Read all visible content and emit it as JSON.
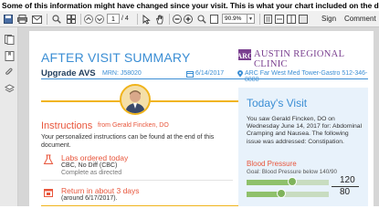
{
  "banner": "Some of this information might have changed since your visit. This is what your chart included on the day of your visit.",
  "toolbar": {
    "page_current": "1",
    "page_total": "/ 4",
    "zoom": "90.9%",
    "sign_label": "Sign",
    "comment_label": "Comment"
  },
  "document": {
    "title": "AFTER VISIT SUMMARY",
    "clinic_name": "AUSTIN REGIONAL CLINIC",
    "patient_name": "Upgrade AVS",
    "mrn": "MRN: J58020",
    "visit_date": "6/14/2017",
    "location": "ARC Far West Med Tower-Gastro 512-346-8888",
    "instructions": {
      "title": "Instructions",
      "from": "from Gerald Fincken, DO",
      "body": "Your personalized instructions can be found at the end of this document."
    },
    "labs": {
      "title": "Labs ordered today",
      "line1": "CBC, No Diff (CBC)",
      "line2": "Complete as directed"
    },
    "return": {
      "title": "Return in about 3 days",
      "when": "(around 6/17/2017)."
    },
    "todays_visit": {
      "title": "Today's Visit",
      "body": "You saw Gerald Fincken, DO on Wednesday June 14, 2017 for: Abdominal Cramping and Nausea. The following issue was addressed: Constipation.",
      "bp_title": "Blood Pressure",
      "bp_goal": "Goal: Blood Pressure below 140/90",
      "systolic": "120",
      "diastolic": "80",
      "systolic_fraction": 0.55,
      "diastolic_fraction": 0.42
    }
  },
  "colors": {
    "accent_blue": "#3b8ed4",
    "accent_orange": "#e8563c",
    "gold": "#f0b41c",
    "clinic_purple": "#7a3f8f"
  }
}
